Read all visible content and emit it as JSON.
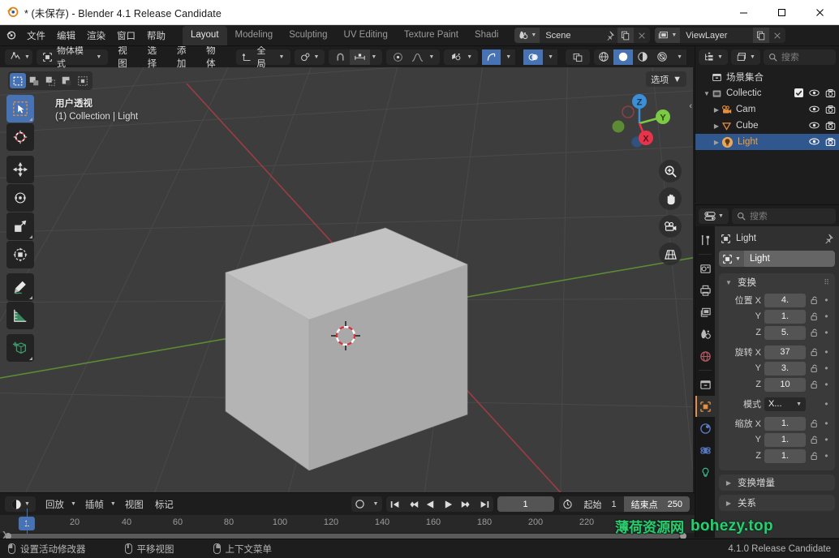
{
  "window": {
    "title": "* (未保存) - Blender 4.1 Release Candidate",
    "minimize": "—",
    "maximize": "□",
    "close": "✕"
  },
  "topbar": {
    "menus": [
      "文件",
      "编辑",
      "渲染",
      "窗口",
      "帮助"
    ],
    "workspace_tabs": [
      {
        "label": "Layout",
        "active": true
      },
      {
        "label": "Modeling",
        "active": false
      },
      {
        "label": "Sculpting",
        "active": false
      },
      {
        "label": "UV Editing",
        "active": false
      },
      {
        "label": "Texture Paint",
        "active": false
      },
      {
        "label": "Shadi",
        "active": false
      }
    ],
    "scene": {
      "name": "Scene",
      "browse_icon": "scene-icon",
      "pin_icon": "pin-icon",
      "new_icon": "duplicate-icon",
      "unlink_icon": "close-icon"
    },
    "viewlayer": {
      "name": "ViewLayer",
      "browse_icon": "viewlayer-icon",
      "new_icon": "duplicate-icon",
      "unlink_icon": "close-icon"
    }
  },
  "viewport_header": {
    "editor_type_icon": "editor-type-3dview-icon",
    "mode": "物体模式",
    "menus": [
      "视图",
      "选择",
      "添加",
      "物体"
    ],
    "transform_orientation": "全局",
    "snap_icon": "magnet-icon",
    "proportional_icon": "proportional-edit-icon",
    "visibility_icon": "object-types-visibility-icon",
    "gizmo_icon": "gizmo-icon",
    "overlays_icon": "overlays-icon",
    "xray_icon": "xray-icon",
    "shading": [
      "wireframe",
      "solid",
      "material",
      "rendered"
    ],
    "shading_active": "solid"
  },
  "viewport": {
    "select_modes": [
      "set",
      "extend",
      "subtract",
      "invert",
      "intersect"
    ],
    "select_mode_active": 0,
    "options_label": "选项",
    "view_label": "用户透视",
    "context_label": "(1) Collection | Light",
    "gizmo_axes": [
      {
        "name": "Z",
        "color": "#3b8fd6"
      },
      {
        "name": "Y",
        "color": "#7cc943"
      },
      {
        "name": "X",
        "color": "#e6354b"
      }
    ],
    "nav_buttons": [
      "zoom-icon",
      "hand-pan-icon",
      "camera-view-icon",
      "perspective-toggle-icon"
    ],
    "tools": [
      {
        "name": "tweak-select-box-tool",
        "active": true
      },
      {
        "name": "cursor-tool",
        "active": false
      },
      {
        "name": "move-tool",
        "active": false
      },
      {
        "name": "rotate-tool",
        "active": false
      },
      {
        "name": "scale-tool",
        "active": false
      },
      {
        "name": "transform-tool",
        "active": false
      },
      {
        "name": "annotate-tool",
        "active": false
      },
      {
        "name": "measure-tool",
        "active": false
      },
      {
        "name": "add-cube-tool",
        "active": false
      }
    ]
  },
  "outliner": {
    "display_mode_icon": "outliner-icon",
    "filter_icon": "filter-icon",
    "search_placeholder": "搜索",
    "rows": [
      {
        "name": "场景集合",
        "icon": "scene-collection-icon",
        "indent": 0,
        "selected": false,
        "expand": "",
        "has_checkbox": false,
        "has_eye": false,
        "has_camera": false
      },
      {
        "name": "Collectic",
        "icon": "collection-icon",
        "indent": 1,
        "selected": false,
        "expand": "v",
        "has_checkbox": true,
        "has_eye": true,
        "has_camera": true
      },
      {
        "name": "Cam",
        "icon": "camera-data-icon",
        "indent": 2,
        "selected": false,
        "expand": ">",
        "has_checkbox": false,
        "has_eye": true,
        "has_camera": true
      },
      {
        "name": "Cube",
        "icon": "mesh-data-icon",
        "indent": 2,
        "selected": false,
        "expand": ">",
        "has_checkbox": false,
        "has_eye": true,
        "has_camera": true
      },
      {
        "name": "Light",
        "icon": "light-data-icon",
        "indent": 2,
        "selected": true,
        "expand": ">",
        "has_checkbox": false,
        "has_eye": true,
        "has_camera": true
      }
    ]
  },
  "properties": {
    "editor_icon": "properties-editor-icon",
    "search_placeholder": "搜索",
    "breadcrumb": "Light",
    "pin_icon": "pin-icon",
    "id_name": "Light",
    "tabs": [
      {
        "name": "tool-tab",
        "active": false
      },
      {
        "name": "render-tab",
        "active": false
      },
      {
        "name": "output-tab",
        "active": false
      },
      {
        "name": "view-layer-tab",
        "active": false
      },
      {
        "name": "scene-tab",
        "active": false
      },
      {
        "name": "world-tab",
        "active": false
      },
      {
        "name": "collection-tab",
        "active": false
      },
      {
        "name": "object-tab",
        "active": true
      },
      {
        "name": "modifiers-tab",
        "active": false
      },
      {
        "name": "physics-tab",
        "active": false
      },
      {
        "name": "object-data-light-tab",
        "active": false
      }
    ],
    "transform_panel": {
      "title": "变换",
      "position_label": "位置",
      "rotation_label": "旋转",
      "mode_label": "模式",
      "scale_label": "缩放",
      "axes": [
        "X",
        "Y",
        "Z"
      ],
      "position": [
        "4.",
        "1.",
        "5."
      ],
      "rotation": [
        "37",
        "3.",
        "10"
      ],
      "rotation_mode": "X...",
      "scale": [
        "1.",
        "1.",
        "1."
      ],
      "delta_transform_label": "变换增量",
      "relations_label": "关系"
    }
  },
  "timeline": {
    "editor_icon": "timeline-editor-icon",
    "menus": [
      "回放",
      "插帧",
      "视图",
      "标记"
    ],
    "record_icon": "record-icon",
    "playback_buttons": [
      "jump-start-icon",
      "prev-keyframe-icon",
      "play-reverse-icon",
      "play-icon",
      "next-keyframe-icon",
      "jump-end-icon"
    ],
    "current_frame": "1",
    "clock_icon": "clock-icon",
    "start_label": "起始",
    "start_value": "1",
    "end_label": "结束点",
    "end_value": "250",
    "ruler_ticks": [
      "20",
      "40",
      "60",
      "80",
      "100",
      "120",
      "140",
      "160",
      "180",
      "200",
      "220"
    ],
    "playhead_frame": "1"
  },
  "statusbar": {
    "items": [
      {
        "icon": "mouse-left-icon",
        "label": "设置活动修改器"
      },
      {
        "icon": "mouse-middle-icon",
        "label": "平移视图"
      },
      {
        "icon": "mouse-right-icon",
        "label": "上下文菜单"
      }
    ],
    "version": "4.1.0 Release Candidate"
  },
  "watermark": {
    "text1": "薄荷资源网",
    "text2": "bohezy.top",
    "color": "#2ecc71"
  }
}
